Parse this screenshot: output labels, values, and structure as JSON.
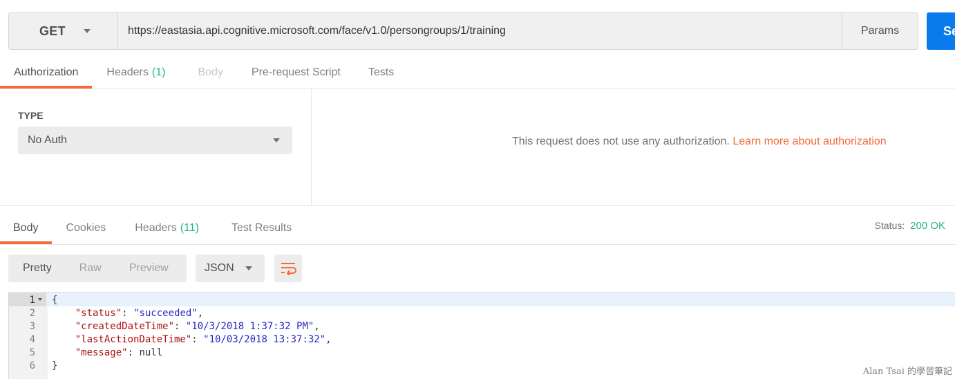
{
  "request": {
    "method": "GET",
    "url": "https://eastasia.api.cognitive.microsoft.com/face/v1.0/persongroups/1/training",
    "params_label": "Params",
    "send_label": "Se"
  },
  "request_tabs": [
    {
      "label": "Authorization",
      "count": "",
      "state": "active"
    },
    {
      "label": "Headers",
      "count": "(1)",
      "state": "normal"
    },
    {
      "label": "Body",
      "count": "",
      "state": "disabled"
    },
    {
      "label": "Pre-request Script",
      "count": "",
      "state": "normal"
    },
    {
      "label": "Tests",
      "count": "",
      "state": "normal"
    }
  ],
  "auth": {
    "type_label": "TYPE",
    "type_value": "No Auth",
    "message": "This request does not use any authorization.",
    "link": "Learn more about authorization"
  },
  "response_tabs": [
    {
      "label": "Body",
      "count": "",
      "state": "active"
    },
    {
      "label": "Cookies",
      "count": "",
      "state": "normal"
    },
    {
      "label": "Headers",
      "count": "(11)",
      "state": "normal"
    },
    {
      "label": "Test Results",
      "count": "",
      "state": "normal"
    }
  ],
  "status": {
    "label": "Status:",
    "value": "200 OK"
  },
  "view_modes": [
    "Pretty",
    "Raw",
    "Preview"
  ],
  "active_view": "Pretty",
  "format": "JSON",
  "code_lines": [
    {
      "n": "1",
      "text": "{"
    },
    {
      "n": "2",
      "key": "\"status\"",
      "value": "\"succeeded\"",
      "tail": ","
    },
    {
      "n": "3",
      "key": "\"createdDateTime\"",
      "value": "\"10/3/2018 1:37:32 PM\"",
      "tail": ","
    },
    {
      "n": "4",
      "key": "\"lastActionDateTime\"",
      "value": "\"10/03/2018 13:37:32\"",
      "tail": ","
    },
    {
      "n": "5",
      "key": "\"message\"",
      "literal": "null",
      "tail": ""
    },
    {
      "n": "6",
      "text": "}"
    }
  ],
  "watermark": "Alan Tsai 的學習筆記",
  "colors": {
    "accent": "#f26b3a",
    "send": "#097bed",
    "success": "#26b47f"
  }
}
